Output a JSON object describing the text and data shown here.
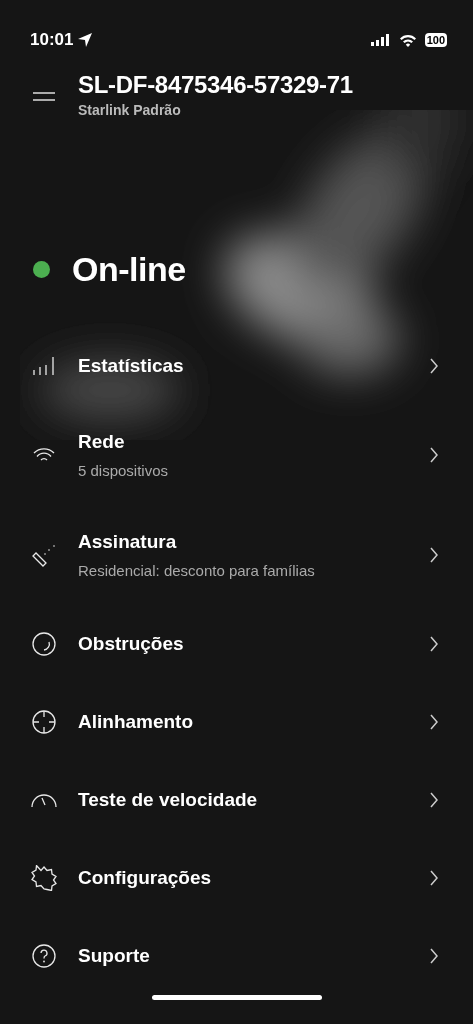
{
  "status_bar": {
    "time": "10:01",
    "battery": "100"
  },
  "header": {
    "title": "SL-DF-8475346-57329-71",
    "subtitle": "Starlink Padrão"
  },
  "connection": {
    "label": "On-line",
    "online": true
  },
  "menu": [
    {
      "label": "Estatísticas"
    },
    {
      "label": "Rede",
      "detail": "5 dispositivos"
    },
    {
      "label": "Assinatura",
      "detail": "Residencial: desconto para famílias"
    },
    {
      "label": "Obstruções"
    },
    {
      "label": "Alinhamento"
    },
    {
      "label": "Teste de velocidade"
    },
    {
      "label": "Configurações"
    },
    {
      "label": "Suporte"
    }
  ]
}
